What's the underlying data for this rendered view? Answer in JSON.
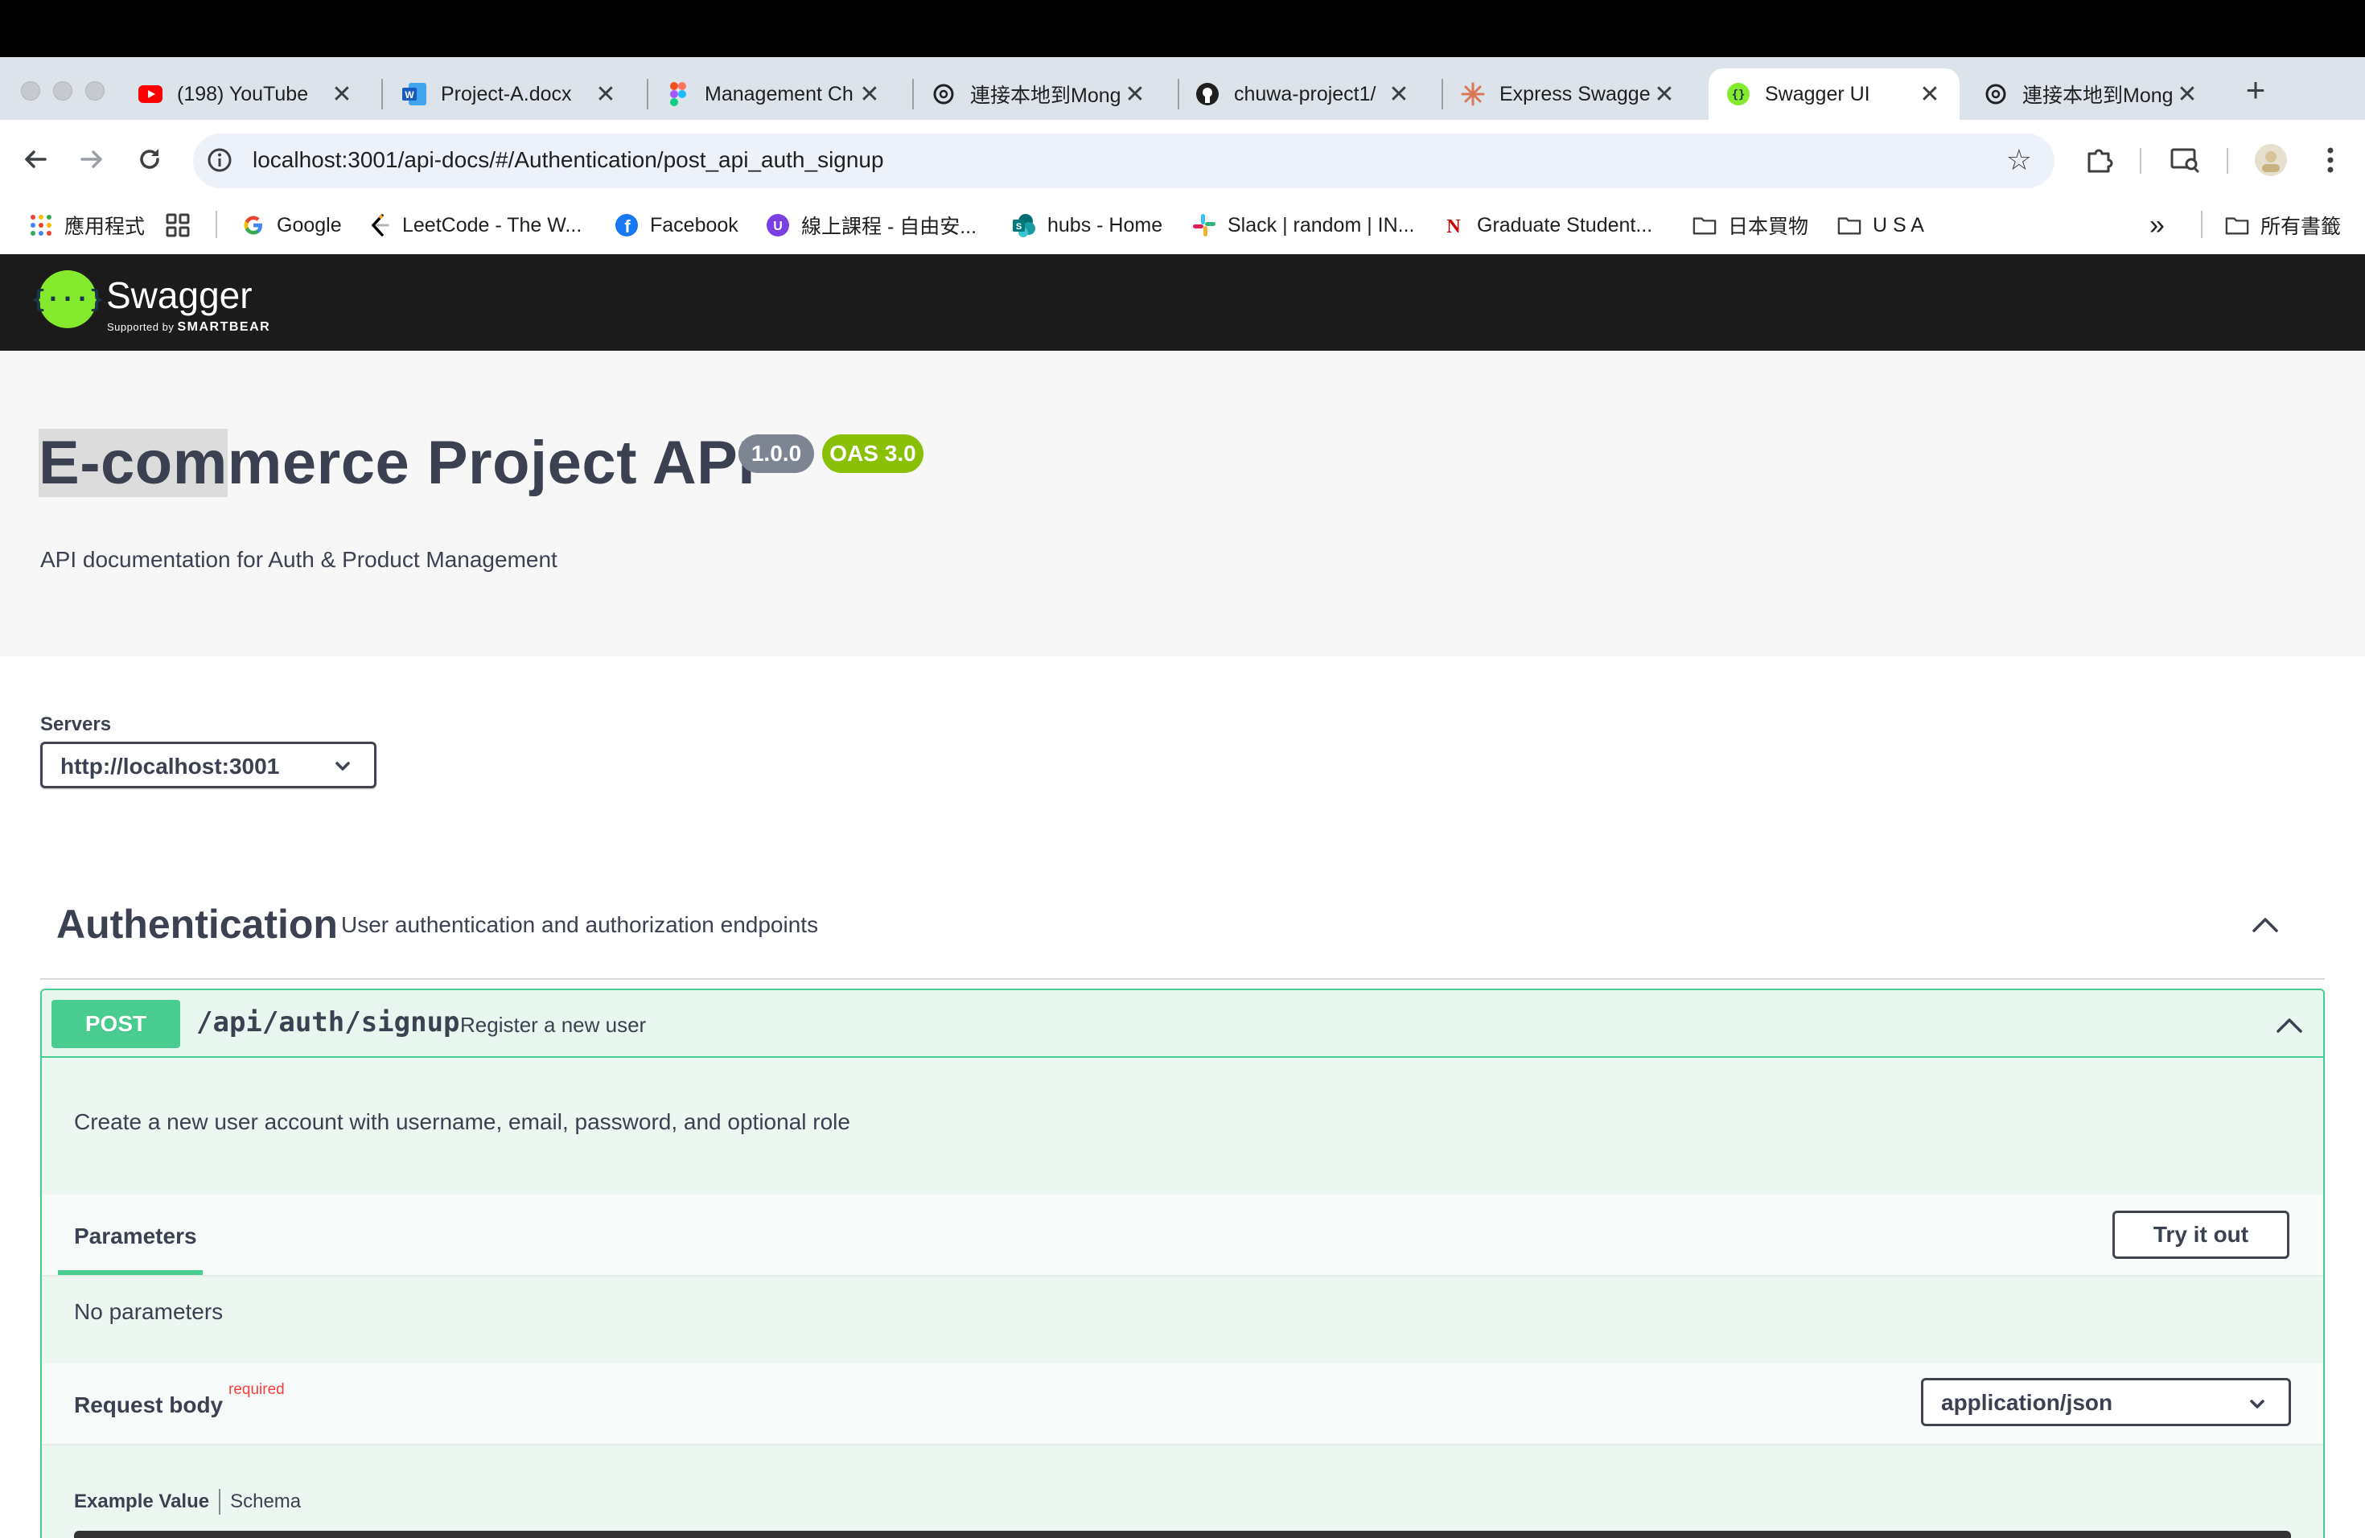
{
  "browser": {
    "tabs": [
      {
        "title": "(198) YouTube",
        "icon": "youtube-icon",
        "active": false
      },
      {
        "title": "Project-A.docx",
        "icon": "word-icon",
        "active": false
      },
      {
        "title": "Management Ch",
        "icon": "figma-icon",
        "active": false
      },
      {
        "title": "連接本地到Mong",
        "icon": "chatgpt-icon",
        "active": false
      },
      {
        "title": "chuwa-project1/",
        "icon": "github-icon",
        "active": false
      },
      {
        "title": "Express Swagge",
        "icon": "claude-icon",
        "active": false
      },
      {
        "title": "Swagger UI",
        "icon": "swagger-icon",
        "active": true
      },
      {
        "title": "連接本地到Mong",
        "icon": "chatgpt-icon",
        "active": false
      }
    ],
    "close_glyph": "✕",
    "new_tab_glyph": "+",
    "url": "localhost:3001/api-docs/#/Authentication/post_api_auth_signup",
    "bookmarks": [
      {
        "label": "應用程式",
        "icon": "apps-grid-icon"
      },
      {
        "label": "",
        "icon": "tab-groups-icon"
      },
      {
        "label": "Google",
        "icon": "google-icon"
      },
      {
        "label": "LeetCode - The W...",
        "icon": "leetcode-icon"
      },
      {
        "label": "Facebook",
        "icon": "facebook-icon"
      },
      {
        "label": "線上課程 - 自由安...",
        "icon": "course-icon"
      },
      {
        "label": "hubs - Home",
        "icon": "sharepoint-icon"
      },
      {
        "label": "Slack | random | IN...",
        "icon": "slack-icon"
      },
      {
        "label": "Graduate Student...",
        "icon": "northeastern-icon"
      },
      {
        "label": "日本買物",
        "icon": "folder-icon"
      },
      {
        "label": "U S A",
        "icon": "folder-icon"
      }
    ],
    "all_bookmarks_label": "所有書籤",
    "more_bookmarks_glyph": "»"
  },
  "swagger": {
    "logo_glyph": "{···}",
    "name": "Swagger",
    "supported_by": "Supported by",
    "smartbear": "SMARTBEAR"
  },
  "info": {
    "title_selected": "E-com",
    "title_rest": "merce Project API",
    "version": "1.0.0",
    "oas": "OAS 3.0",
    "description": "API documentation for Auth & Product Management",
    "version_color": "#7d8492",
    "oas_color": "#89bf04"
  },
  "servers": {
    "label": "Servers",
    "selected": "http://localhost:3001"
  },
  "tag": {
    "name": "Authentication",
    "description": "User authentication and authorization endpoints"
  },
  "operation": {
    "method": "POST",
    "path": "/api/auth/signup",
    "summary": "Register a new user",
    "description": "Create a new user account with username, email, password, and optional role",
    "parameters_tab": "Parameters",
    "try_it_out": "Try it out",
    "no_parameters": "No parameters",
    "request_body_label": "Request body",
    "required_label": "required",
    "content_type": "application/json",
    "example_value_tab": "Example Value",
    "schema_tab": "Schema",
    "method_color": "#49cc90"
  }
}
